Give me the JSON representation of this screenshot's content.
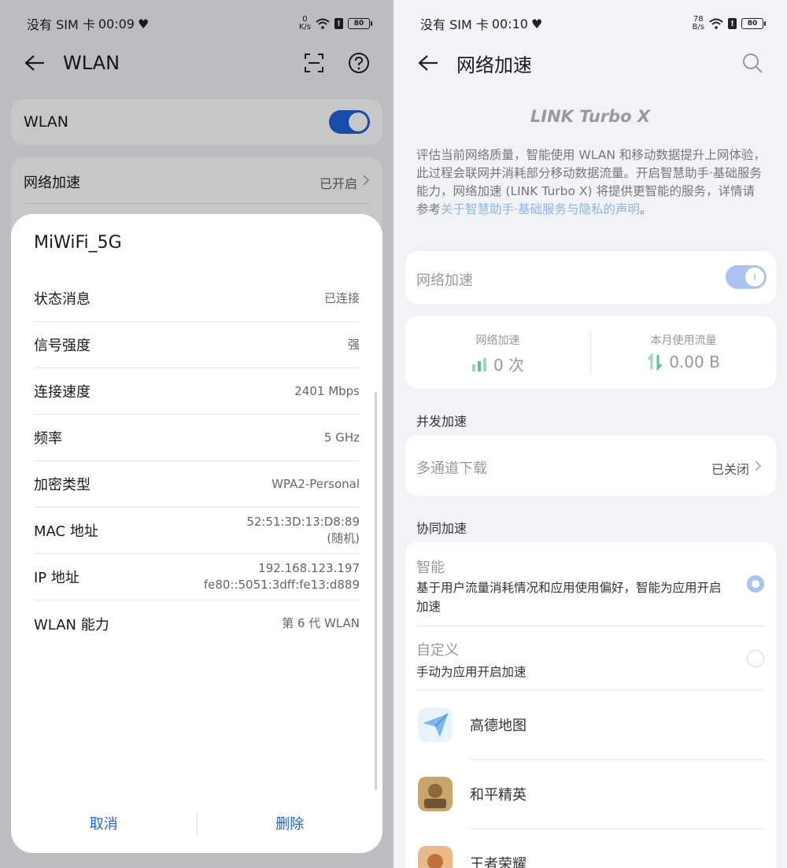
{
  "left": {
    "status": {
      "carrier": "没有 SIM 卡",
      "time": "00:09",
      "net_speed_value": "0",
      "net_speed_unit": "K/s",
      "battery": "80"
    },
    "title": "WLAN",
    "wlan_row": {
      "label": "WLAN",
      "enabled": true
    },
    "accel_row": {
      "label": "网络加速",
      "value": "已开启"
    },
    "dialog": {
      "title": "MiWiFi_5G",
      "rows": [
        {
          "key": "状态消息",
          "value": "已连接"
        },
        {
          "key": "信号强度",
          "value": "强"
        },
        {
          "key": "连接速度",
          "value": "2401 Mbps"
        },
        {
          "key": "频率",
          "value": "5 GHz"
        },
        {
          "key": "加密类型",
          "value": "WPA2-Personal"
        },
        {
          "key": "MAC 地址",
          "value": "52:51:3D:13:D8:89",
          "value2": "(随机)"
        },
        {
          "key": "IP 地址",
          "value": "192.168.123.197",
          "value2": "fe80::5051:3dff:fe13:d889"
        },
        {
          "key": "WLAN 能力",
          "value": "第 6 代 WLAN"
        }
      ],
      "cancel": "取消",
      "delete": "删除"
    }
  },
  "right": {
    "status": {
      "carrier": "没有 SIM 卡",
      "time": "00:10",
      "net_speed_value": "78",
      "net_speed_unit": "B/s",
      "battery": "80"
    },
    "title": "网络加速",
    "logo": "LINK Turbo X",
    "desc_text": "评估当前网络质量，智能使用 WLAN 和移动数据提升上网体验，此过程会联网并消耗部分移动数据流量。开启智慧助手·基础服务能力，网络加速 (LINK Turbo X) 将提供更智能的服务，详情请参考",
    "desc_link": "关于智慧助手·基础服务与隐私的声明",
    "desc_end": "。",
    "accel_toggle": {
      "label": "网络加速",
      "enabled": true
    },
    "stats": {
      "count_label": "网络加速",
      "count_value": "0 次",
      "traffic_label": "本月使用流量",
      "traffic_value": "0.00 B"
    },
    "concurrent": {
      "header": "并发加速",
      "multi_label": "多通道下载",
      "multi_value": "已关闭"
    },
    "coop": {
      "header": "协同加速",
      "smart_title": "智能",
      "smart_desc": "基于用户流量消耗情况和应用使用偏好，智能为应用开启加速",
      "custom_title": "自定义",
      "custom_desc": "手动为应用开启加速",
      "apps": [
        "高德地图",
        "和平精英",
        "王者荣耀"
      ]
    },
    "colors": {
      "accent": "#1e62d8",
      "link": "#8fb4ec",
      "chart_green": "#5fc28a"
    }
  }
}
